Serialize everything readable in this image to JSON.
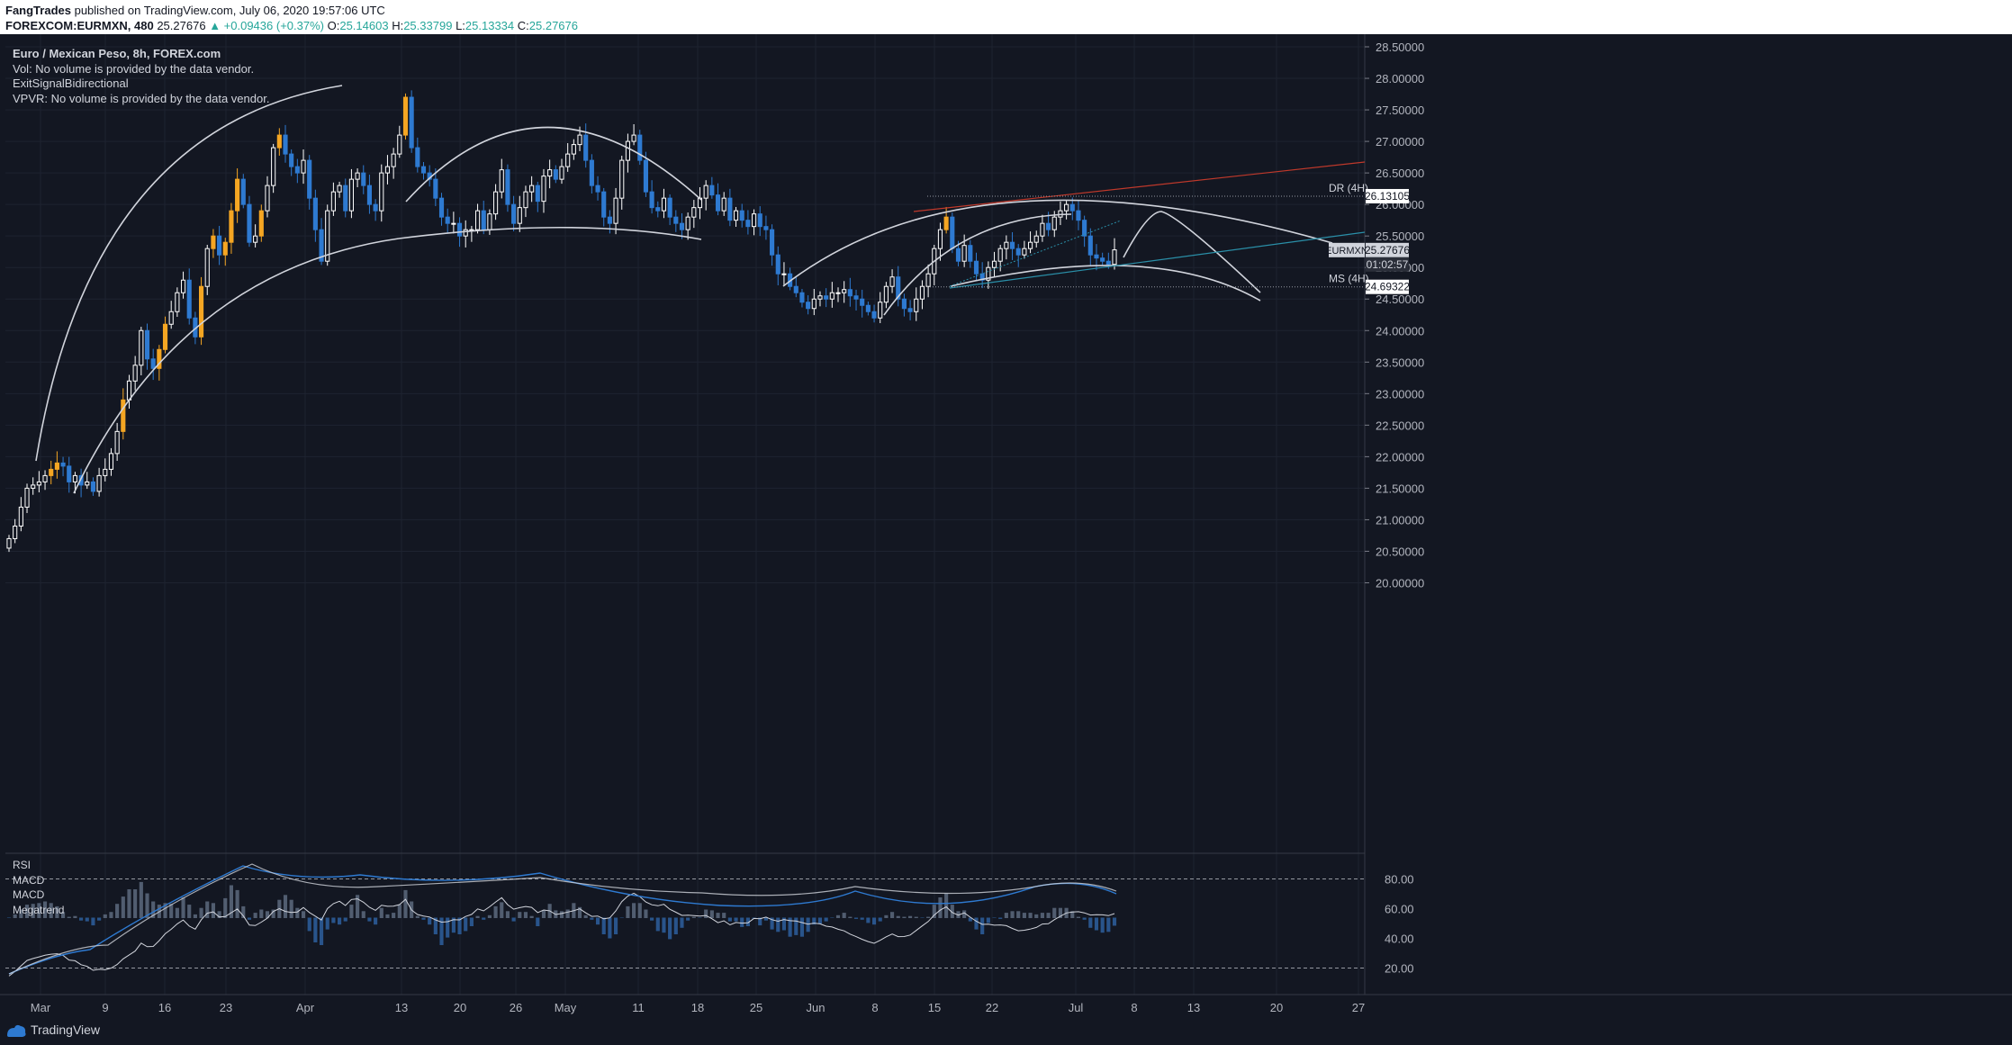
{
  "header": {
    "author": "FangTrades",
    "published_text": "published on TradingView.com, July 06, 2020 19:57:06 UTC",
    "symbol_line": "FOREXCOM:EURMXN, 480",
    "last": "25.27676",
    "change": "▲ +0.09436 (+0.37%)",
    "ohlc": {
      "o_label": "O:",
      "o": "25.14603",
      "h_label": "H:",
      "h": "25.33799",
      "l_label": "L:",
      "l": "25.13334",
      "c_label": "C:",
      "c": "25.27676"
    }
  },
  "legend": {
    "title": "Euro / Mexican Peso, 8h, FOREX.com",
    "lines": [
      "Vol: No volume is provided by the data vendor.",
      "ExitSignalBidirectional",
      "VPVR: No volume is provided by the data vendor."
    ]
  },
  "indicators": [
    "RSI",
    "MACD",
    "MACD",
    "Megatrend"
  ],
  "footer": {
    "brand": "TradingView"
  },
  "colors": {
    "background": "#131722",
    "grid": "#1e2330",
    "up": "#ffffff",
    "down": "#2e7ad1",
    "signal": "#f5a623",
    "annotation": "#d1d4dc",
    "red_line": "#c0392b",
    "teal_line": "#2a8fa8",
    "rsi": "#2e7ad1"
  },
  "chart_data": {
    "type": "candlestick",
    "symbol": "EURMXN",
    "timeframe": "8h",
    "y_axis_ticks": [
      "28.50000",
      "28.00000",
      "27.50000",
      "27.00000",
      "26.50000",
      "26.00000",
      "25.50000",
      "25.00000",
      "24.50000",
      "24.00000",
      "23.50000",
      "23.00000",
      "22.50000",
      "22.00000",
      "21.50000",
      "21.00000",
      "20.50000",
      "20.00000"
    ],
    "ylim": [
      19.85,
      28.7
    ],
    "x_axis_ticks": [
      "Mar",
      "9",
      "16",
      "23",
      "Apr",
      "13",
      "20",
      "26",
      "May",
      "11",
      "18",
      "25",
      "Jun",
      "8",
      "15",
      "22",
      "Jul",
      "8",
      "13",
      "20",
      "27"
    ],
    "price_labels": [
      {
        "text": "EURMXN",
        "value": "25.27676"
      },
      {
        "text": "",
        "value": "01:02:57"
      }
    ],
    "levels": [
      {
        "name": "DR (4H)",
        "value": "26.13105"
      },
      {
        "name": "MS (4H)",
        "value": "24.69322"
      }
    ],
    "rsi_levels": [
      "80.00",
      "60.00",
      "40.00",
      "20.00"
    ],
    "closes": [
      20.7,
      20.9,
      21.2,
      21.5,
      21.55,
      21.6,
      21.7,
      21.8,
      21.9,
      21.85,
      21.6,
      21.7,
      21.55,
      21.6,
      21.45,
      21.7,
      21.8,
      22.05,
      22.4,
      22.9,
      23.2,
      23.45,
      24.0,
      23.55,
      23.4,
      23.7,
      24.1,
      24.3,
      24.6,
      24.8,
      24.2,
      23.9,
      24.7,
      25.3,
      25.5,
      25.2,
      25.4,
      25.9,
      26.4,
      26.0,
      25.4,
      25.5,
      25.9,
      26.3,
      26.9,
      27.1,
      26.8,
      26.6,
      26.5,
      26.7,
      26.1,
      25.6,
      25.1,
      25.9,
      26.2,
      26.3,
      25.9,
      26.4,
      26.5,
      26.3,
      26.0,
      25.9,
      26.5,
      26.6,
      26.8,
      27.1,
      27.7,
      26.9,
      26.6,
      26.5,
      26.4,
      26.1,
      25.8,
      25.7,
      25.7,
      25.5,
      25.6,
      25.6,
      25.9,
      25.6,
      25.85,
      26.2,
      26.55,
      26.0,
      25.7,
      25.95,
      26.2,
      26.3,
      26.05,
      26.45,
      26.55,
      26.4,
      26.6,
      26.8,
      26.95,
      27.1,
      26.7,
      26.3,
      26.2,
      25.8,
      25.7,
      26.1,
      26.7,
      27.0,
      27.1,
      26.7,
      26.2,
      25.95,
      25.9,
      26.1,
      25.8,
      25.7,
      25.6,
      25.8,
      25.95,
      26.1,
      26.3,
      26.15,
      25.9,
      26.1,
      25.75,
      25.9,
      25.75,
      25.65,
      25.85,
      25.65,
      25.6,
      25.2,
      24.9,
      24.9,
      24.7,
      24.6,
      24.45,
      24.35,
      24.5,
      24.55,
      24.5,
      24.6,
      24.6,
      24.65,
      24.55,
      24.5,
      24.4,
      24.3,
      24.2,
      24.45,
      24.7,
      24.85,
      24.5,
      24.35,
      24.3,
      24.5,
      24.7,
      24.9,
      25.3,
      25.6,
      25.8,
      25.3,
      25.1,
      25.35,
      25.1,
      24.9,
      24.8,
      25.0,
      25.1,
      25.3,
      25.4,
      25.3,
      25.2,
      25.3,
      25.4,
      25.5,
      25.7,
      25.6,
      25.8,
      25.9,
      26.0,
      25.9,
      25.75,
      25.5,
      25.2,
      25.15,
      25.1,
      25.05,
      25.28
    ]
  }
}
